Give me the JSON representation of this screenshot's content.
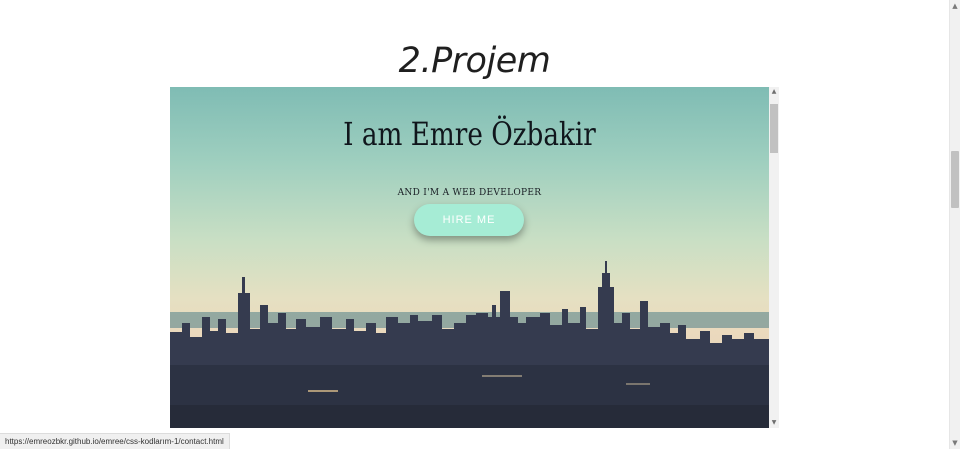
{
  "page": {
    "title": "2.Projem"
  },
  "preview": {
    "hero_title": "I am Emre Özbakir",
    "hero_subtitle": "and I'm a web developer",
    "hire_button_label": "HIRE ME"
  },
  "status_bar": {
    "url": "https://emreozbkr.github.io/emree/css-kodlarım-1/contact.html"
  },
  "colors": {
    "hire_button": "#a6ecd5",
    "sky_top": "#7fbcb4",
    "sky_horizon": "#ebd9bd",
    "city": "#343a4e"
  },
  "icons": {
    "scroll_up": "triangle-up",
    "scroll_down": "triangle-down"
  }
}
